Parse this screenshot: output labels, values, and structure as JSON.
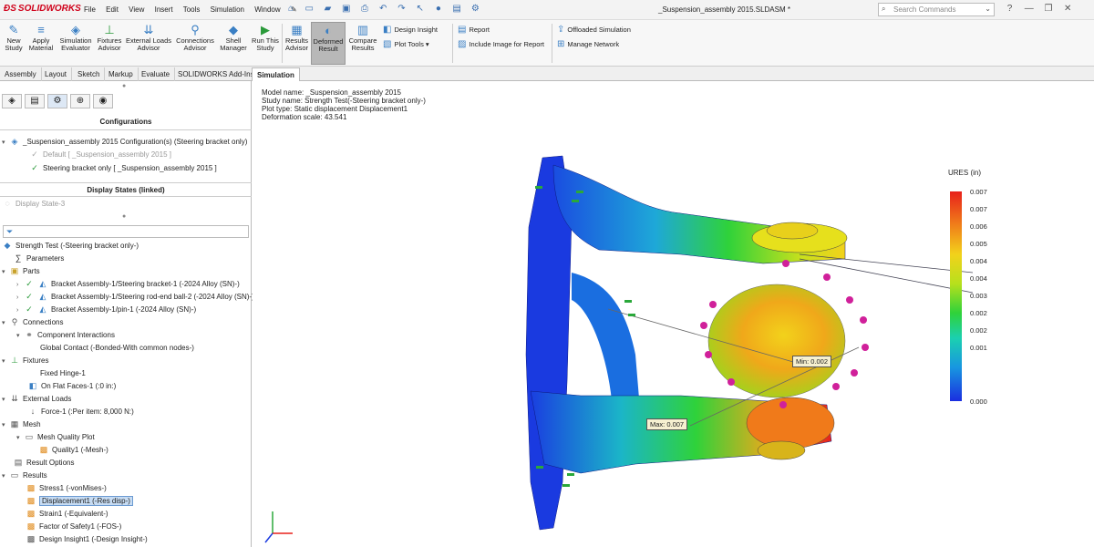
{
  "app": {
    "logo": "SOLIDWORKS",
    "doc_title": "_Suspension_assembly 2015.SLDASM *"
  },
  "menu": [
    "File",
    "Edit",
    "View",
    "Insert",
    "Tools",
    "Simulation",
    "Window"
  ],
  "search": {
    "placeholder": "Search Commands"
  },
  "ribbon": {
    "new_study": [
      "New",
      "Study"
    ],
    "apply_material": [
      "Apply",
      "Material"
    ],
    "sim_eval": [
      "Simulation",
      "Evaluator"
    ],
    "fixtures": [
      "Fixtures",
      "Advisor"
    ],
    "ext_loads": [
      "External Loads",
      "Advisor"
    ],
    "connections": [
      "Connections",
      "Advisor"
    ],
    "shell": [
      "Shell",
      "Manager"
    ],
    "run": [
      "Run This",
      "Study"
    ],
    "results_adv": [
      "Results",
      "Advisor"
    ],
    "deformed": [
      "Deformed",
      "Result"
    ],
    "compare": [
      "Compare",
      "Results"
    ],
    "design_insight": "Design Insight",
    "plot_tools": "Plot Tools",
    "report": "Report",
    "include_image": "Include Image for Report",
    "offloaded": "Offloaded Simulation",
    "manage_network": "Manage Network"
  },
  "tabs": [
    "Assembly",
    "Layout",
    "Sketch",
    "Markup",
    "Evaluate",
    "SOLIDWORKS Add-Ins",
    "Simulation"
  ],
  "panel": {
    "configurations": "Configurations",
    "config_root": "_Suspension_assembly 2015 Configuration(s)  (Steering bracket only)",
    "config_default": "Default [ _Suspension_assembly 2015 ]",
    "config_steering": "Steering bracket only [ _Suspension_assembly 2015 ]",
    "display_states": "Display States (linked)",
    "display_state": "Display State-3",
    "tree": {
      "study": "Strength Test (-Steering bracket only-)",
      "parameters": "Parameters",
      "parts": "Parts",
      "part1": "Bracket Assembly-1/Steering bracket-1 (-2024 Alloy (SN)-)",
      "part2": "Bracket Assembly-1/Steering rod-end ball-2 (-2024 Alloy (SN)-)",
      "part3": "Bracket Assembly-1/pin-1 (-2024 Alloy (SN)-)",
      "connections": "Connections",
      "comp_int": "Component Interactions",
      "global_contact": "Global Contact (-Bonded-With common nodes-)",
      "fixtures": "Fixtures",
      "fixed_hinge": "Fixed Hinge-1",
      "flat_faces": "On Flat Faces-1 (:0 in:)",
      "ext_loads": "External Loads",
      "force": "Force-1 (:Per item: 8,000 N:)",
      "mesh": "Mesh",
      "mesh_quality": "Mesh Quality Plot",
      "quality1": "Quality1 (-Mesh-)",
      "result_options": "Result Options",
      "results": "Results",
      "stress": "Stress1 (-vonMises-)",
      "displacement": "Displacement1 (-Res disp-)",
      "strain": "Strain1 (-Equivalent-)",
      "fos": "Factor of Safety1 (-FOS-)",
      "design_insight": "Design Insight1 (-Design Insight-)"
    }
  },
  "viewport": {
    "info": [
      "Model name: _Suspension_assembly 2015",
      "Study name: Strength Test(-Steering bracket only-)",
      "Plot type: Static displacement Displacement1",
      "Deformation scale: 43.541"
    ],
    "legend_title": "URES (in)",
    "legend_ticks": [
      "0.007",
      "0.007",
      "0.006",
      "0.005",
      "0.004",
      "0.004",
      "0.003",
      "0.002",
      "0.002",
      "0.001",
      "0.000"
    ],
    "min_label": "Min: 0.002",
    "max_label": "Max: 0.007"
  }
}
